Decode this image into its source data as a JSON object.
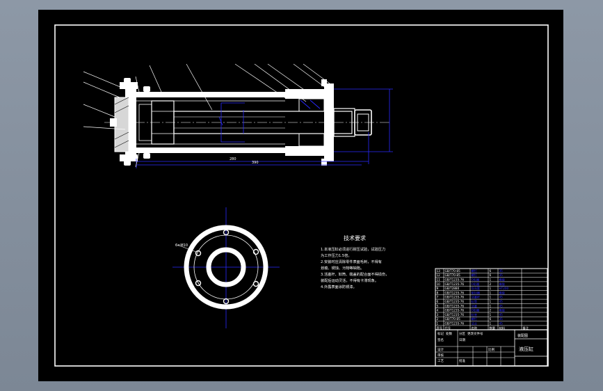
{
  "drawing": {
    "tech_title": "技术要求",
    "tech_lines": [
      "1.本液压缸必须进行耐压试验，试验压力",
      "为工作压力1.5倍。",
      "2.安装时应清除零件表面毛刺，不得有",
      "划痕、锈蚀、污物等缺陷。",
      "3.活塞杆、缸筒、端盖的配合面不得损伤，",
      "装配后运动灵活，不得有卡滞现象。",
      "4.外露表面涂防锈漆。"
    ],
    "main_dims": [
      "280",
      "390"
    ],
    "hole_note": "6×M10",
    "parts_header": [
      "序号",
      "代号",
      "名称",
      "数量",
      "材料",
      "备注"
    ],
    "parts_rows": [
      [
        "13",
        "GB/T70-85",
        "螺钉",
        "6",
        "35",
        ""
      ],
      [
        "12",
        "GB/T70-85",
        "螺钉",
        "6",
        "35",
        ""
      ],
      [
        "11",
        "GB/T1235-76",
        "O形圈",
        "1",
        "橡胶",
        ""
      ],
      [
        "10",
        "GB/T1235-76",
        "O形圈",
        "2",
        "橡胶",
        ""
      ],
      [
        "9",
        "GB/T2880",
        "导向套",
        "1",
        "HT200",
        ""
      ],
      [
        "8",
        "GB/T1235-76",
        "密封圈",
        "1",
        "橡胶",
        ""
      ],
      [
        "7",
        "GB/T1235-76",
        "活塞杆",
        "1",
        "45",
        ""
      ],
      [
        "6",
        "GB/T1235-76",
        "缸筒",
        "1",
        "45",
        ""
      ],
      [
        "5",
        "GB/T1235-76",
        "活塞",
        "1",
        "45",
        ""
      ],
      [
        "4",
        "GB/T1235-76",
        "O形圈",
        "2",
        "橡胶",
        ""
      ],
      [
        "3",
        "GB/T1235-76",
        "缸底",
        "1",
        "45",
        ""
      ],
      [
        "2",
        "GB/T70-85",
        "螺钉",
        "6",
        "35",
        ""
      ],
      [
        "1",
        "GB/T1235-76",
        "法兰",
        "1",
        "45",
        ""
      ]
    ],
    "title_block": {
      "drawing_name": "液压缸",
      "subtitle": "装配图",
      "scale_label": "比例",
      "labels": [
        "标记",
        "处数",
        "分区",
        "更改文件号",
        "签名",
        "日期",
        "设计",
        "审核",
        "工艺",
        "批准"
      ]
    },
    "colors": {
      "paper": "#000000",
      "frame": "#ffffff",
      "geometry": "#ffffff",
      "dimension": "#2a2aff",
      "background": "#8792a0"
    }
  }
}
